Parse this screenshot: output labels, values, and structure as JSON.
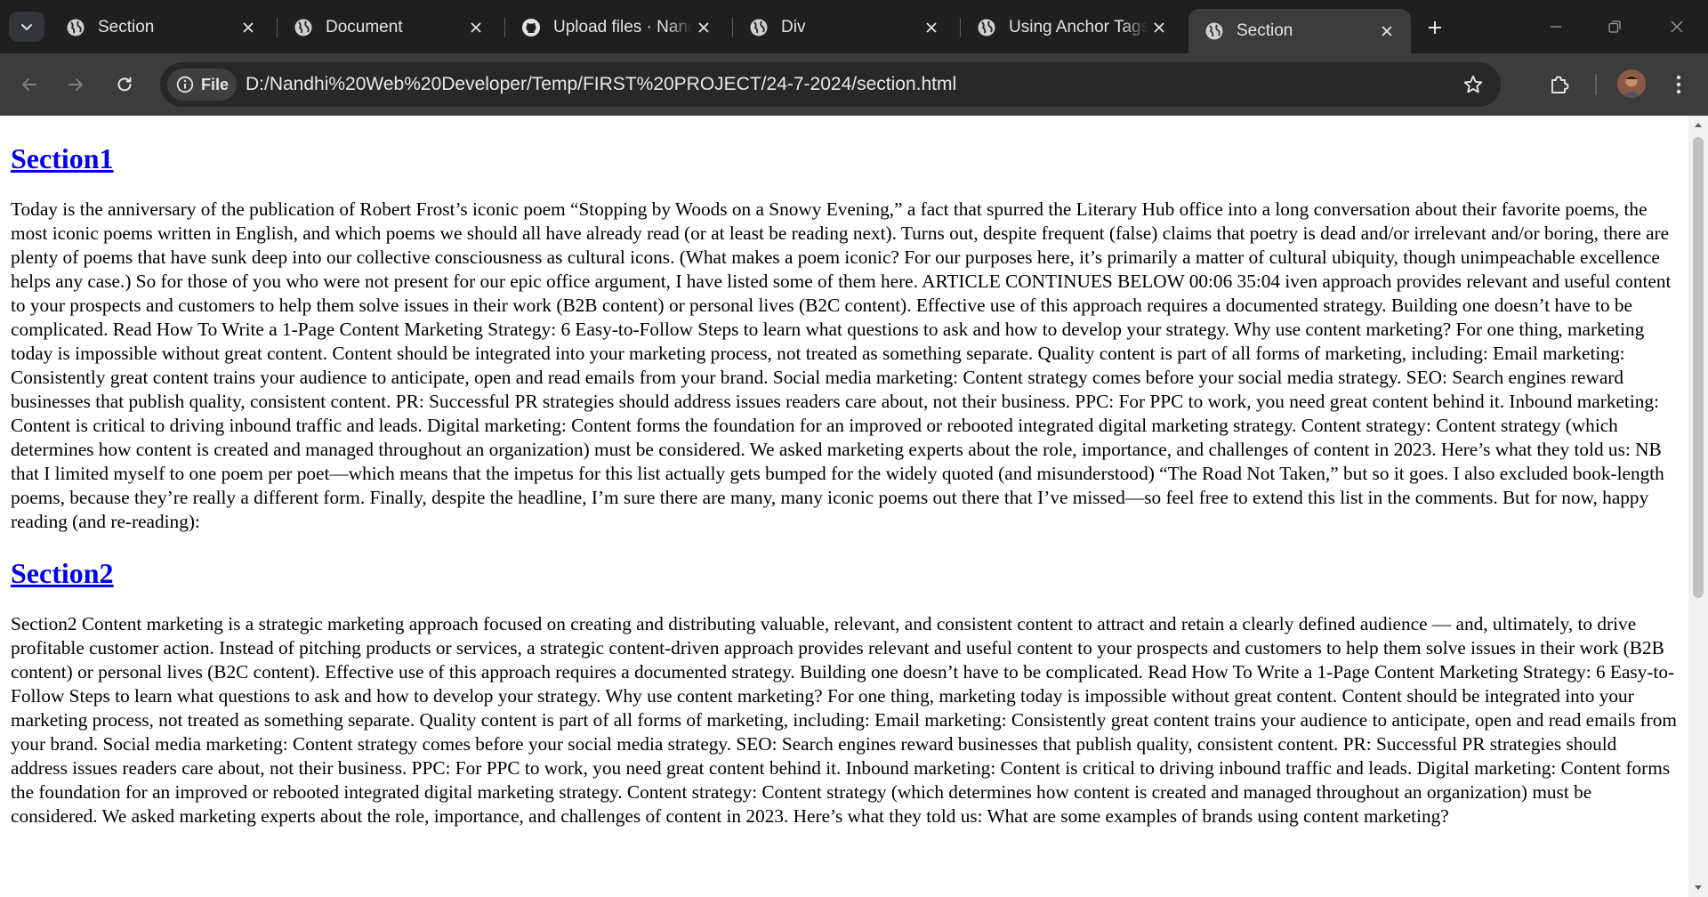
{
  "browser": {
    "tabs": [
      {
        "title": "Section",
        "icon": "globe-icon",
        "active": false
      },
      {
        "title": "Document",
        "icon": "globe-icon",
        "active": false
      },
      {
        "title": "Upload files · Nandhi",
        "icon": "github-icon",
        "active": false
      },
      {
        "title": "Div",
        "icon": "globe-icon",
        "active": false
      },
      {
        "title": "Using Anchor Tags",
        "icon": "globe-icon",
        "active": false
      },
      {
        "title": "Section",
        "icon": "globe-icon",
        "active": true
      }
    ],
    "address": {
      "chip_label": "File",
      "url": "D:/Nandhi%20Web%20Developer/Temp/FIRST%20PROJECT/24-7-2024/section.html"
    },
    "colors": {
      "tabstrip": "#1f1f1f",
      "toolbar": "#3c3c3c",
      "link": "#0000ee"
    }
  },
  "page": {
    "sections": [
      {
        "heading": "Section1",
        "body": "Today is the anniversary of the publication of Robert Frost’s iconic poem “Stopping by Woods on a Snowy Evening,” a fact that spurred the Literary Hub office into a long conversation about their favorite poems, the most iconic poems written in English, and which poems we should all have already read (or at least be reading next). Turns out, despite frequent (false) claims that poetry is dead and/or irrelevant and/or boring, there are plenty of poems that have sunk deep into our collective consciousness as cultural icons. (What makes a poem iconic? For our purposes here, it’s primarily a matter of cultural ubiquity, though unimpeachable excellence helps any case.) So for those of you who were not present for our epic office argument, I have listed some of them here. ARTICLE CONTINUES BELOW 00:06 35:04 iven approach provides relevant and useful content to your prospects and customers to help them solve issues in their work (B2B content) or personal lives (B2C content). Effective use of this approach requires a documented strategy. Building one doesn’t have to be complicated. Read How To Write a 1-Page Content Marketing Strategy: 6 Easy-to-Follow Steps to learn what questions to ask and how to develop your strategy. Why use content marketing? For one thing, marketing today is impossible without great content. Content should be integrated into your marketing process, not treated as something separate. Quality content is part of all forms of marketing, including: Email marketing: Consistently great content trains your audience to anticipate, open and read emails from your brand. Social media marketing: Content strategy comes before your social media strategy. SEO: Search engines reward businesses that publish quality, consistent content. PR: Successful PR strategies should address issues readers care about, not their business. PPC: For PPC to work, you need great content behind it. Inbound marketing: Content is critical to driving inbound traffic and leads. Digital marketing: Content forms the foundation for an improved or rebooted integrated digital marketing strategy. Content strategy: Content strategy (which determines how content is created and managed throughout an organization) must be considered. We asked marketing experts about the role, importance, and challenges of content in 2023. Here’s what they told us: NB that I limited myself to one poem per poet—which means that the impetus for this list actually gets bumped for the widely quoted (and misunderstood) “The Road Not Taken,” but so it goes. I also excluded book-length poems, because they’re really a different form. Finally, despite the headline, I’m sure there are many, many iconic poems out there that I’ve missed—so feel free to extend this list in the comments. But for now, happy reading (and re-reading):"
      },
      {
        "heading": "Section2",
        "body": "Section2 Content marketing is a strategic marketing approach focused on creating and distributing valuable, relevant, and consistent content to attract and retain a clearly defined audience — and, ultimately, to drive profitable customer action. Instead of pitching products or services, a strategic content-driven approach provides relevant and useful content to your prospects and customers to help them solve issues in their work (B2B content) or personal lives (B2C content). Effective use of this approach requires a documented strategy. Building one doesn’t have to be complicated. Read How To Write a 1-Page Content Marketing Strategy: 6 Easy-to-Follow Steps to learn what questions to ask and how to develop your strategy. Why use content marketing? For one thing, marketing today is impossible without great content. Content should be integrated into your marketing process, not treated as something separate. Quality content is part of all forms of marketing, including: Email marketing: Consistently great content trains your audience to anticipate, open and read emails from your brand. Social media marketing: Content strategy comes before your social media strategy. SEO: Search engines reward businesses that publish quality, consistent content. PR: Successful PR strategies should address issues readers care about, not their business. PPC: For PPC to work, you need great content behind it. Inbound marketing: Content is critical to driving inbound traffic and leads. Digital marketing: Content forms the foundation for an improved or rebooted integrated digital marketing strategy. Content strategy: Content strategy (which determines how content is created and managed throughout an organization) must be considered. We asked marketing experts about the role, importance, and challenges of content in 2023. Here’s what they told us: What are some examples of brands using content marketing?"
      }
    ]
  }
}
